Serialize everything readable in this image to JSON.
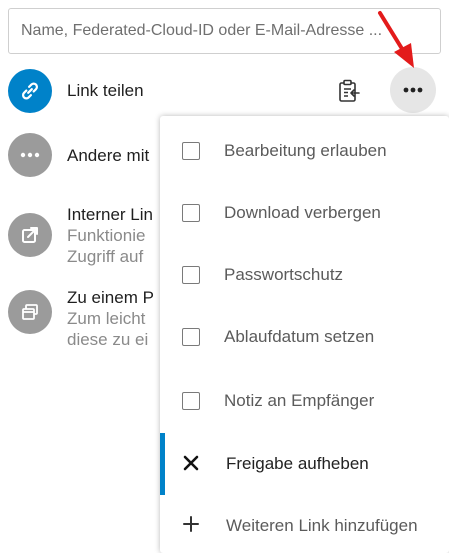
{
  "share": {
    "search_placeholder": "Name, Federated-Cloud-ID oder E-Mail-Adresse ..."
  },
  "rows": {
    "link": {
      "title": "Link teilen"
    },
    "others": {
      "title": "Andere mit"
    },
    "internal": {
      "title": "Interner Lin",
      "sub1": "Funktionie",
      "sub2": "Zugriff auf"
    },
    "project": {
      "title": "Zu einem P",
      "sub1": "Zum leicht",
      "sub2": "diese zu ei"
    }
  },
  "menu": {
    "items": [
      {
        "label": "Bearbeitung erlauben",
        "icon": "checkbox-icon"
      },
      {
        "label": "Download verbergen",
        "icon": "checkbox-icon"
      },
      {
        "label": "Passwortschutz",
        "icon": "checkbox-icon"
      },
      {
        "label": "Ablaufdatum setzen",
        "icon": "checkbox-icon"
      },
      {
        "label": "Notiz an Empfänger",
        "icon": "checkbox-icon"
      },
      {
        "label": "Freigabe aufheben",
        "icon": "close-icon"
      },
      {
        "label": "Weiteren Link hinzufügen",
        "icon": "plus-icon"
      }
    ]
  },
  "colors": {
    "accent": "#0082c9",
    "avatar_grey": "#9b9b9b",
    "arrow_red": "#e31b1b"
  }
}
